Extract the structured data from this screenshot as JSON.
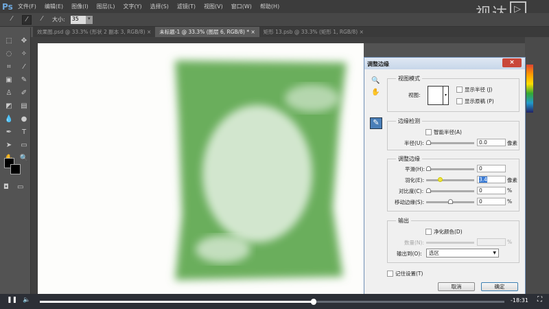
{
  "app": {
    "logo": "Ps"
  },
  "menu": [
    "文件(F)",
    "编辑(E)",
    "图像(I)",
    "图层(L)",
    "文字(Y)",
    "选择(S)",
    "滤镜(T)",
    "视图(V)",
    "窗口(W)",
    "帮助(H)"
  ],
  "options": {
    "size_label": "大小:",
    "size_value": "35"
  },
  "tabs": [
    {
      "label": "效果图.psd @ 33.3% (形状 2 副本 3, RGB/8) ×"
    },
    {
      "label": "未标题-1 @ 33.3% (图层 6, RGB/8) * ×"
    },
    {
      "label": "矩形 13.psb @ 33.3% (矩形 1, RGB/8) ×"
    }
  ],
  "watermark": "视达",
  "dialog": {
    "title": "调整边缘",
    "close": "×",
    "view_mode": {
      "title": "视图模式",
      "view_label": "视图:",
      "show_radius": "显示半径 (J)",
      "show_original": "显示原稿 (P)"
    },
    "edge_detection": {
      "title": "边缘检测",
      "smart_radius": "智能半径(A)",
      "radius_label": "半径(U):",
      "radius_value": "0.0",
      "radius_unit": "像素"
    },
    "adjust_edge": {
      "title": "调整边缘",
      "smooth_label": "平滑(H):",
      "smooth_value": "0",
      "feather_label": "羽化(E):",
      "feather_value": "3.4",
      "feather_unit": "像素",
      "contrast_label": "对比度(C):",
      "contrast_value": "0",
      "contrast_unit": "%",
      "shift_label": "移动边缘(S):",
      "shift_value": "0",
      "shift_unit": "%"
    },
    "output": {
      "title": "输出",
      "decontaminate": "净化颜色(D)",
      "amount_label": "数量(N):",
      "amount_unit": "%",
      "output_to_label": "输出到(O):",
      "output_to_value": "选区"
    },
    "remember": "记住设置(T)",
    "cancel": "取消",
    "ok": "确定"
  },
  "player": {
    "time_remaining": "-18:31",
    "progress": 0.59
  }
}
